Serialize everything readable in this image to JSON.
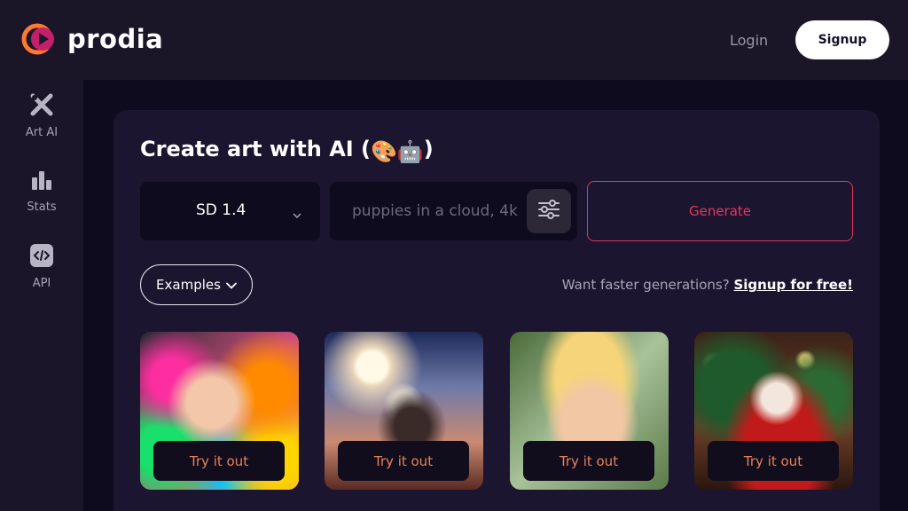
{
  "brand": {
    "name": "prodia",
    "accent": "#e8385d",
    "logo_icon": "play-circle-icon"
  },
  "header": {
    "login_label": "Login",
    "signup_label": "Signup"
  },
  "sidebar": {
    "items": [
      {
        "label": "Art AI",
        "icon": "brush-pencil-icon"
      },
      {
        "label": "Stats",
        "icon": "bar-chart-icon"
      },
      {
        "label": "API",
        "icon": "code-icon"
      }
    ]
  },
  "main": {
    "title": "Create art with AI (",
    "title_emoji": "🎨🤖",
    "title_end": ")",
    "model": {
      "selected": "SD 1.4"
    },
    "prompt": {
      "placeholder": "puppies in a cloud, 4k",
      "value": ""
    },
    "generate_label": "Generate",
    "examples_label": "Examples",
    "promo_text": "Want faster generations?",
    "promo_link": "Signup for free!",
    "gallery": [
      {
        "button": "Try it out",
        "subject": "colorful-splash-woman-portrait"
      },
      {
        "button": "Try it out",
        "subject": "astronaut-on-horse"
      },
      {
        "button": "Try it out",
        "subject": "blonde-woman-portrait"
      },
      {
        "button": "Try it out",
        "subject": "santa-claus-christmas-tree"
      }
    ]
  }
}
